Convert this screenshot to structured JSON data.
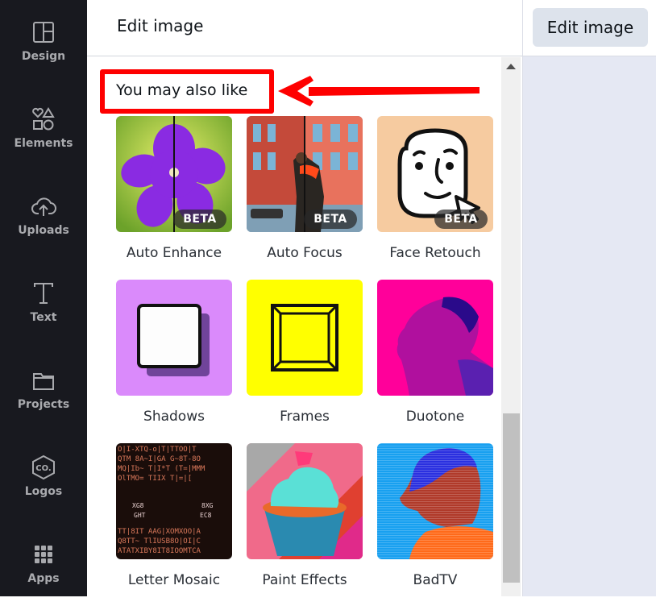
{
  "sidebar": {
    "items": [
      {
        "label": "Design",
        "icon": "layout-icon"
      },
      {
        "label": "Elements",
        "icon": "shapes-icon"
      },
      {
        "label": "Uploads",
        "icon": "cloud-upload-icon"
      },
      {
        "label": "Text",
        "icon": "text-t-icon"
      },
      {
        "label": "Projects",
        "icon": "folder-icon"
      },
      {
        "label": "Logos",
        "icon": "logo-co-icon"
      },
      {
        "label": "Apps",
        "icon": "grid-dots-icon"
      }
    ]
  },
  "panel": {
    "title": "Edit image",
    "section_title": "You may also like",
    "beta_label": "BETA",
    "tiles": [
      {
        "label": "Auto Enhance",
        "beta": true
      },
      {
        "label": "Auto Focus",
        "beta": true
      },
      {
        "label": "Face Retouch",
        "beta": true
      },
      {
        "label": "Shadows",
        "beta": false
      },
      {
        "label": "Frames",
        "beta": false
      },
      {
        "label": "Duotone",
        "beta": false
      },
      {
        "label": "Letter Mosaic",
        "beta": false
      },
      {
        "label": "Paint Effects",
        "beta": false
      },
      {
        "label": "BadTV",
        "beta": false
      }
    ]
  },
  "toolbar": {
    "edit_image_label": "Edit image"
  },
  "colors": {
    "annotation": "#fe0000",
    "rail_bg": "#18191f"
  }
}
